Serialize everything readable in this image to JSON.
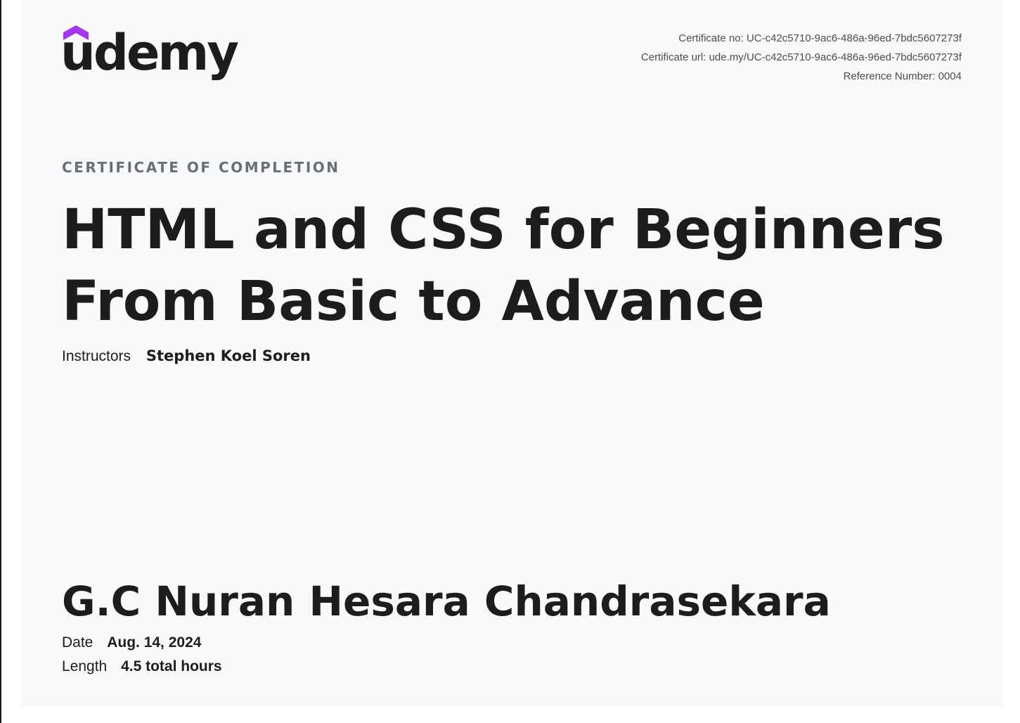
{
  "brand": {
    "name": "udemy",
    "accent_color": "#a435f0",
    "text_color": "#1c1d1f"
  },
  "meta": {
    "certificate_no": "Certificate no: UC-c42c5710-9ac6-486a-96ed-7bdc5607273f",
    "certificate_url": "Certificate url: ude.my/UC-c42c5710-9ac6-486a-96ed-7bdc5607273f",
    "reference_number": "Reference Number: 0004"
  },
  "certificate": {
    "kicker": "CERTIFICATE OF COMPLETION",
    "course_title": "HTML and CSS for Beginners From Basic to Advance",
    "instructors_label": "Instructors",
    "instructors_value": "Stephen Koel Soren",
    "recipient_name": "G.C Nuran Hesara Chandrasekara",
    "date_label": "Date",
    "date_value": "Aug. 14, 2024",
    "length_label": "Length",
    "length_value": "4.5 total hours"
  }
}
